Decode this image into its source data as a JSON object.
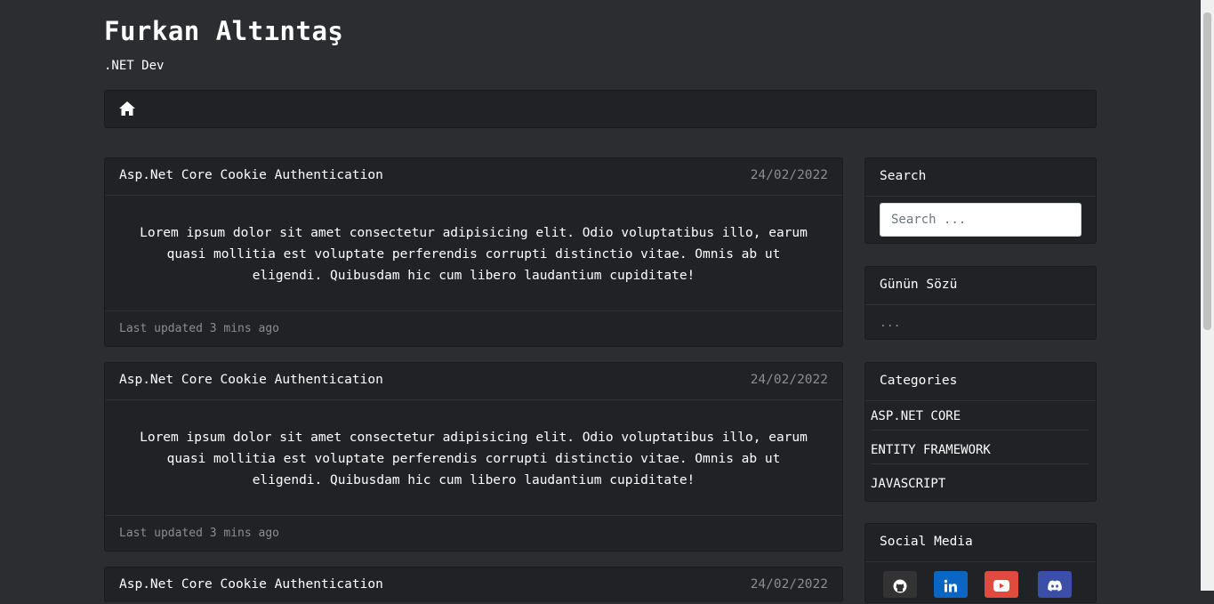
{
  "site": {
    "title": "Furkan Altıntaş",
    "subtitle": ".NET Dev"
  },
  "nav": {
    "home_icon": "home-icon"
  },
  "posts": [
    {
      "title": "Asp.Net Core Cookie Authentication",
      "date": "24/02/2022",
      "body": "Lorem ipsum dolor sit amet consectetur adipisicing elit. Odio voluptatibus illo, earum quasi mollitia est voluptate perferendis corrupti distinctio vitae. Omnis ab ut eligendi. Quibusdam hic cum libero laudantium cupiditate!",
      "updated": "Last updated 3 mins ago"
    },
    {
      "title": "Asp.Net Core Cookie Authentication",
      "date": "24/02/2022",
      "body": "Lorem ipsum dolor sit amet consectetur adipisicing elit. Odio voluptatibus illo, earum quasi mollitia est voluptate perferendis corrupti distinctio vitae. Omnis ab ut eligendi. Quibusdam hic cum libero laudantium cupiditate!",
      "updated": "Last updated 3 mins ago"
    },
    {
      "title": "Asp.Net Core Cookie Authentication",
      "date": "24/02/2022"
    }
  ],
  "sidebar": {
    "search": {
      "title": "Search",
      "placeholder": "Search ..."
    },
    "quote": {
      "title": "Günün Sözü",
      "text": "..."
    },
    "categories": {
      "title": "Categories",
      "items": [
        "ASP.NET CORE",
        "ENTITY FRAMEWORK",
        "JAVASCRIPT"
      ]
    },
    "social": {
      "title": "Social Media",
      "links": [
        {
          "icon": "github-icon",
          "color": "#333333"
        },
        {
          "icon": "linkedin-icon",
          "color": "#0a66c2"
        },
        {
          "icon": "youtube-icon",
          "color": "#e14b3b"
        },
        {
          "icon": "discord-icon",
          "color": "#3b4ea8"
        }
      ]
    }
  }
}
